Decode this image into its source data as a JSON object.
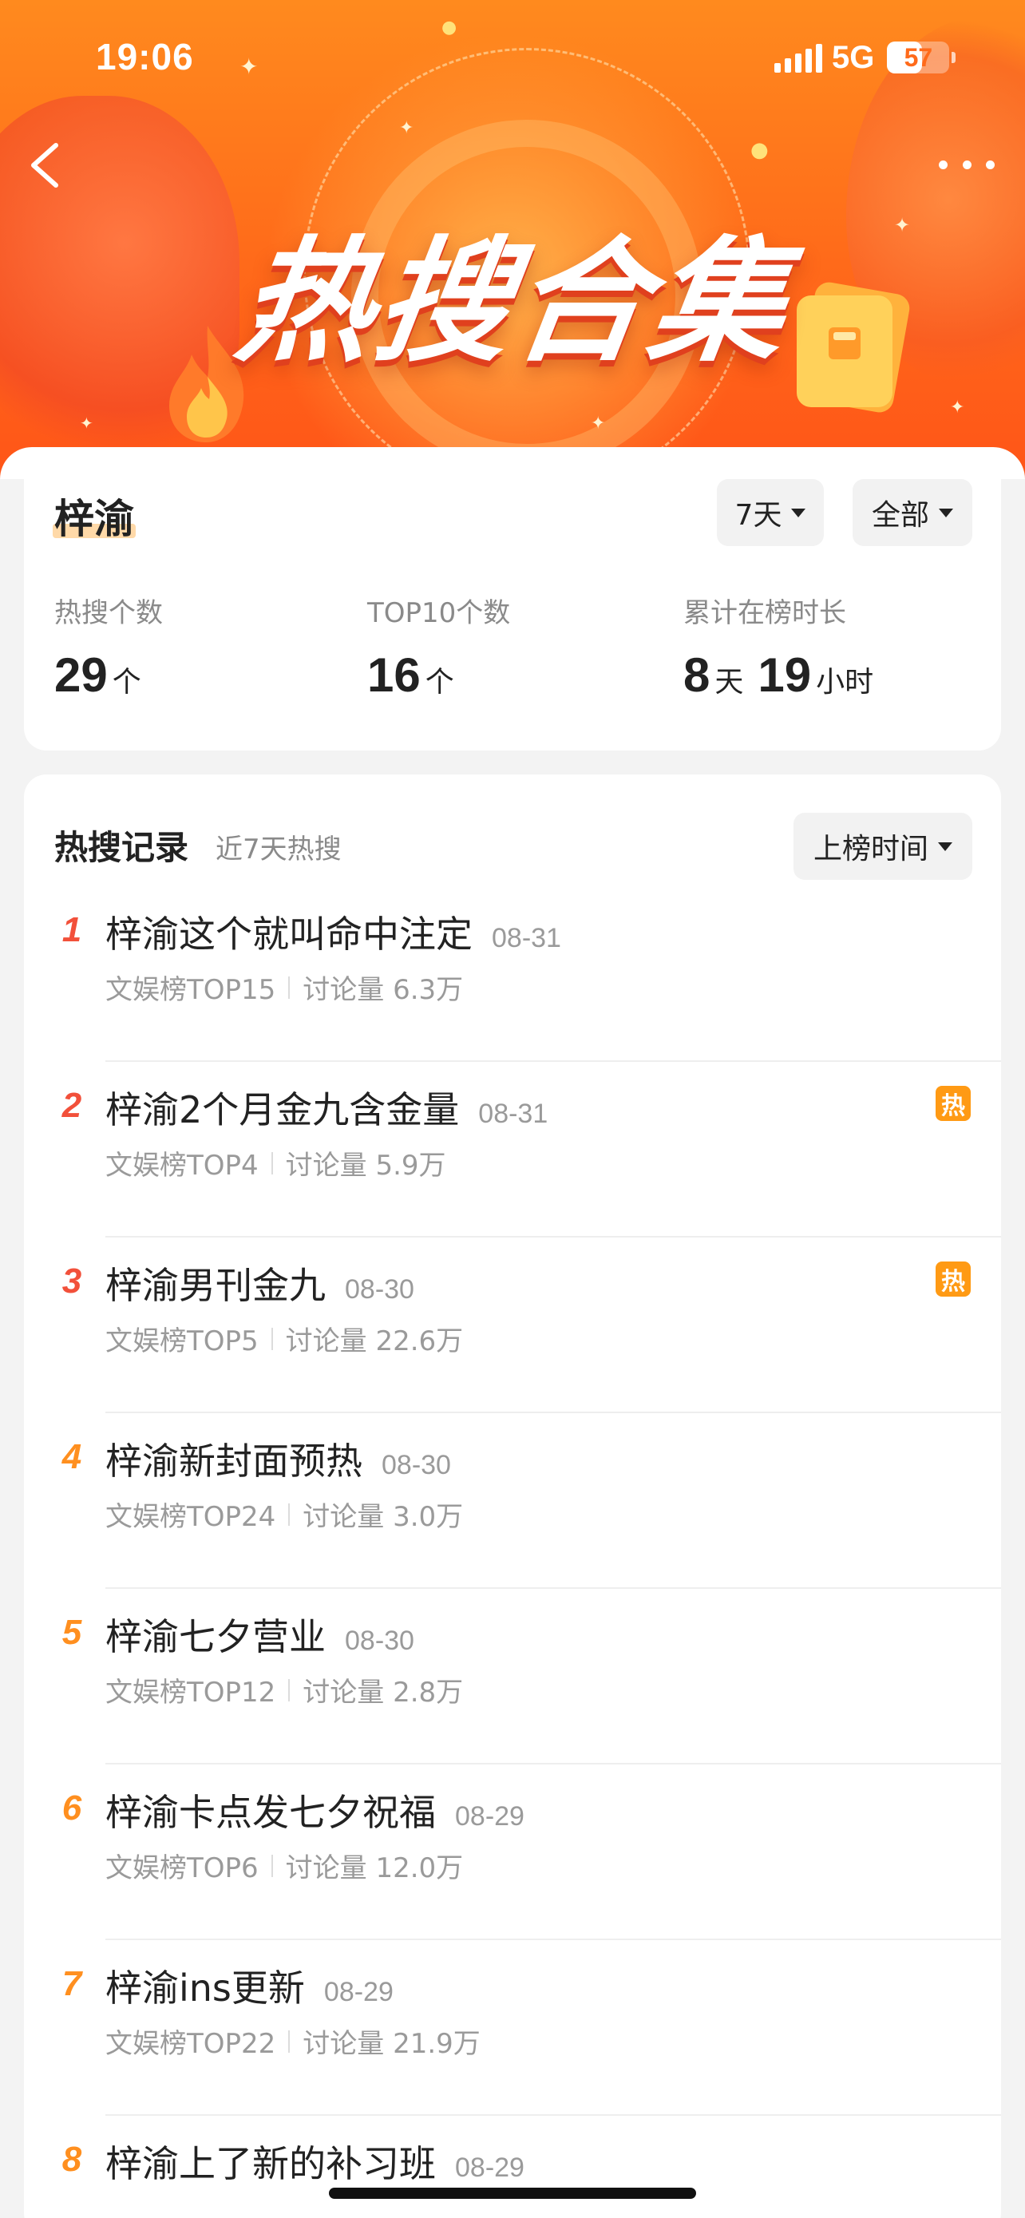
{
  "status_bar": {
    "time": "19:06",
    "network": "5G",
    "battery_level": "57",
    "battery_fraction": 0.57
  },
  "header": {
    "banner_title": "热搜合集",
    "back_icon": "chevron-left-icon",
    "more_icon": "more-horizontal-icon",
    "colors": {
      "banner_top": "#ff8a1e",
      "banner_bottom": "#ff5518"
    }
  },
  "summary": {
    "keyword": "梓渝",
    "filter_days": "7天",
    "filter_scope": "全部",
    "stats": [
      {
        "label": "热搜个数",
        "parts": [
          {
            "num": "29",
            "unit": "个"
          }
        ]
      },
      {
        "label": "TOP10个数",
        "parts": [
          {
            "num": "16",
            "unit": "个"
          }
        ]
      },
      {
        "label": "累计在榜时长",
        "parts": [
          {
            "num": "8",
            "unit": "天"
          },
          {
            "num": "19",
            "unit": "小时"
          }
        ]
      }
    ]
  },
  "records": {
    "title": "热搜记录",
    "subtitle": "近7天热搜",
    "sort_label": "上榜时间",
    "hot_badge_label": "热",
    "colors": {
      "rank_top3": "#f2503a",
      "rank_other": "#ff8f1f",
      "hot_badge": "#ff9a14"
    },
    "items": [
      {
        "rank": "1",
        "title": "梓渝这个就叫命中注定",
        "date": "08-31",
        "board": "文娱榜TOP15",
        "discussion": "讨论量 6.3万",
        "hot": false
      },
      {
        "rank": "2",
        "title": "梓渝2个月金九含金量",
        "date": "08-31",
        "board": "文娱榜TOP4",
        "discussion": "讨论量 5.9万",
        "hot": true
      },
      {
        "rank": "3",
        "title": "梓渝男刊金九",
        "date": "08-30",
        "board": "文娱榜TOP5",
        "discussion": "讨论量 22.6万",
        "hot": true
      },
      {
        "rank": "4",
        "title": "梓渝新封面预热",
        "date": "08-30",
        "board": "文娱榜TOP24",
        "discussion": "讨论量 3.0万",
        "hot": false
      },
      {
        "rank": "5",
        "title": "梓渝七夕营业",
        "date": "08-30",
        "board": "文娱榜TOP12",
        "discussion": "讨论量 2.8万",
        "hot": false
      },
      {
        "rank": "6",
        "title": "梓渝卡点发七夕祝福",
        "date": "08-29",
        "board": "文娱榜TOP6",
        "discussion": "讨论量 12.0万",
        "hot": false
      },
      {
        "rank": "7",
        "title": "梓渝ins更新",
        "date": "08-29",
        "board": "文娱榜TOP22",
        "discussion": "讨论量 21.9万",
        "hot": false
      },
      {
        "rank": "8",
        "title": "梓渝上了新的补习班",
        "date": "08-29",
        "board": "",
        "discussion": "",
        "hot": false
      }
    ]
  }
}
